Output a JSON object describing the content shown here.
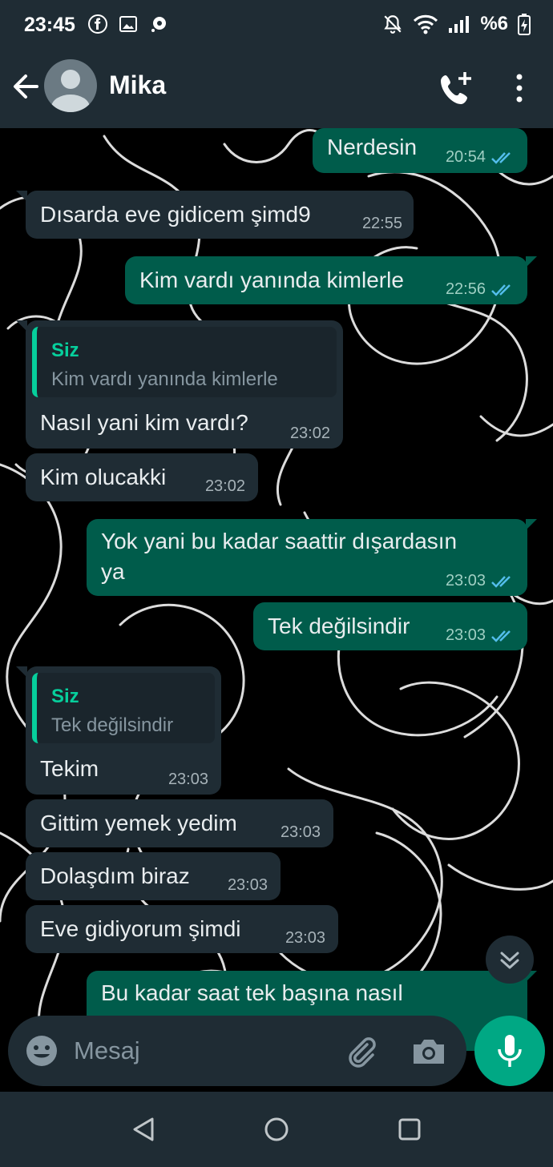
{
  "status_bar": {
    "time": "23:45",
    "battery": "%6"
  },
  "header": {
    "contact_name": "Mika"
  },
  "messages": [
    {
      "dir": "out",
      "text": "Nerdesin",
      "time": "20:54"
    },
    {
      "dir": "in",
      "text": "Dısarda eve gidicem şimd9",
      "time": "22:55"
    },
    {
      "dir": "out",
      "text": "Kim vardı yanında kimlerle",
      "time": "22:56"
    },
    {
      "dir": "in",
      "quote_author": "Siz",
      "quote_text": "Kim vardı yanında kimlerle",
      "text": "Nasıl yani kim vardı?",
      "time": "23:02"
    },
    {
      "dir": "in",
      "text": "Kim olucakki",
      "time": "23:02"
    },
    {
      "dir": "out",
      "text_line1": "Yok yani bu kadar saattir dışardasın",
      "text_line2": "ya",
      "time": "23:03"
    },
    {
      "dir": "out",
      "text": "Tek değilsindir",
      "time": "23:03"
    },
    {
      "dir": "in",
      "quote_author": "Siz",
      "quote_text": "Tek değilsindir",
      "text": "Tekim",
      "time": "23:03"
    },
    {
      "dir": "in",
      "text": "Gittim yemek yedim",
      "time": "23:03"
    },
    {
      "dir": "in",
      "text": "Dolaşdım biraz",
      "time": "23:03"
    },
    {
      "dir": "in",
      "text": "Eve gidiyorum şimdi",
      "time": "23:03"
    },
    {
      "dir": "out",
      "text": "Bu kadar saat tek başına nasıl"
    }
  ],
  "composer": {
    "placeholder": "Mesaj"
  },
  "colors": {
    "header": "#1f2c34",
    "incoming": "#1f2c34",
    "outgoing": "#005c4b",
    "accent": "#00a884",
    "read_tick": "#53bdeb"
  },
  "icons": [
    "back-arrow-icon",
    "avatar-icon",
    "add-call-icon",
    "more-vert-icon",
    "double-check-icon",
    "scroll-down-icon",
    "emoji-icon",
    "attach-icon",
    "camera-icon",
    "mic-icon",
    "nav-back-icon",
    "nav-home-icon",
    "nav-recents-icon"
  ]
}
